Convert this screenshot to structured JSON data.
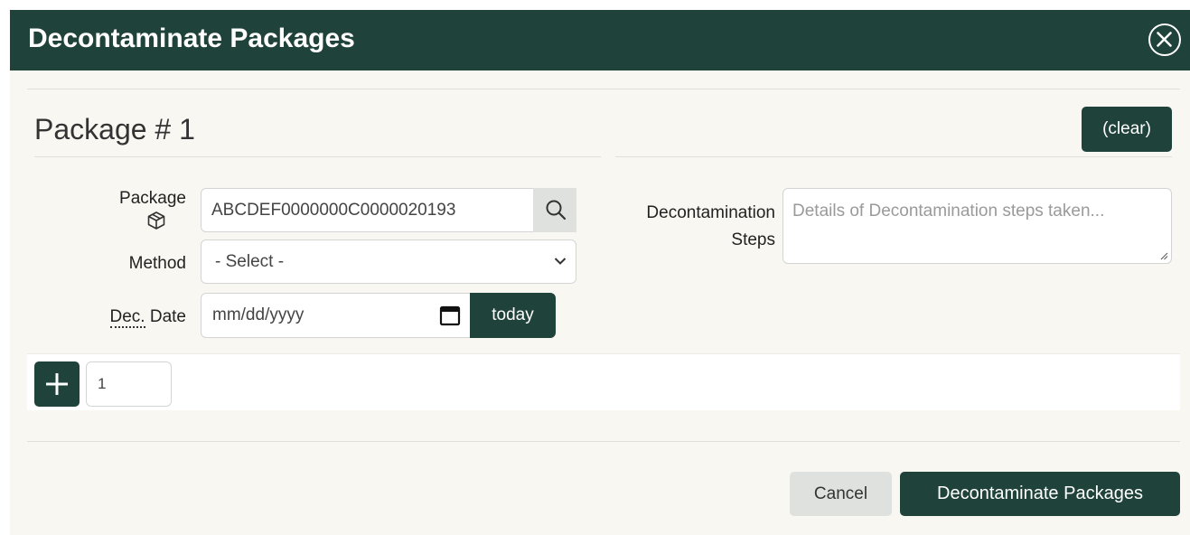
{
  "dialog": {
    "title": "Decontaminate Packages",
    "close_icon": "close-circle-icon"
  },
  "package_section": {
    "title": "Package # 1",
    "clear_label": "(clear)"
  },
  "fields": {
    "package_label": "Package",
    "package_icon": "box-icon",
    "package_value": "ABCDEF0000000C0000020193",
    "search_icon": "search-icon",
    "method_label": "Method",
    "method_selected": "- Select -",
    "date_label_abbr": "Dec.",
    "date_label_rest": " Date",
    "date_placeholder": "mm/dd/yyyy",
    "calendar_icon": "calendar-icon",
    "today_label": "today",
    "steps_label_line1": "Decontamination",
    "steps_label_line2": "Steps",
    "steps_placeholder": "Details of Decontamination steps taken..."
  },
  "add_row": {
    "add_icon": "plus-icon",
    "count_value": "1"
  },
  "footer": {
    "cancel_label": "Cancel",
    "submit_label": "Decontaminate Packages"
  },
  "colors": {
    "primary": "#1f423a",
    "background": "#f8f7f2",
    "secondary_button": "#dfe1df"
  }
}
